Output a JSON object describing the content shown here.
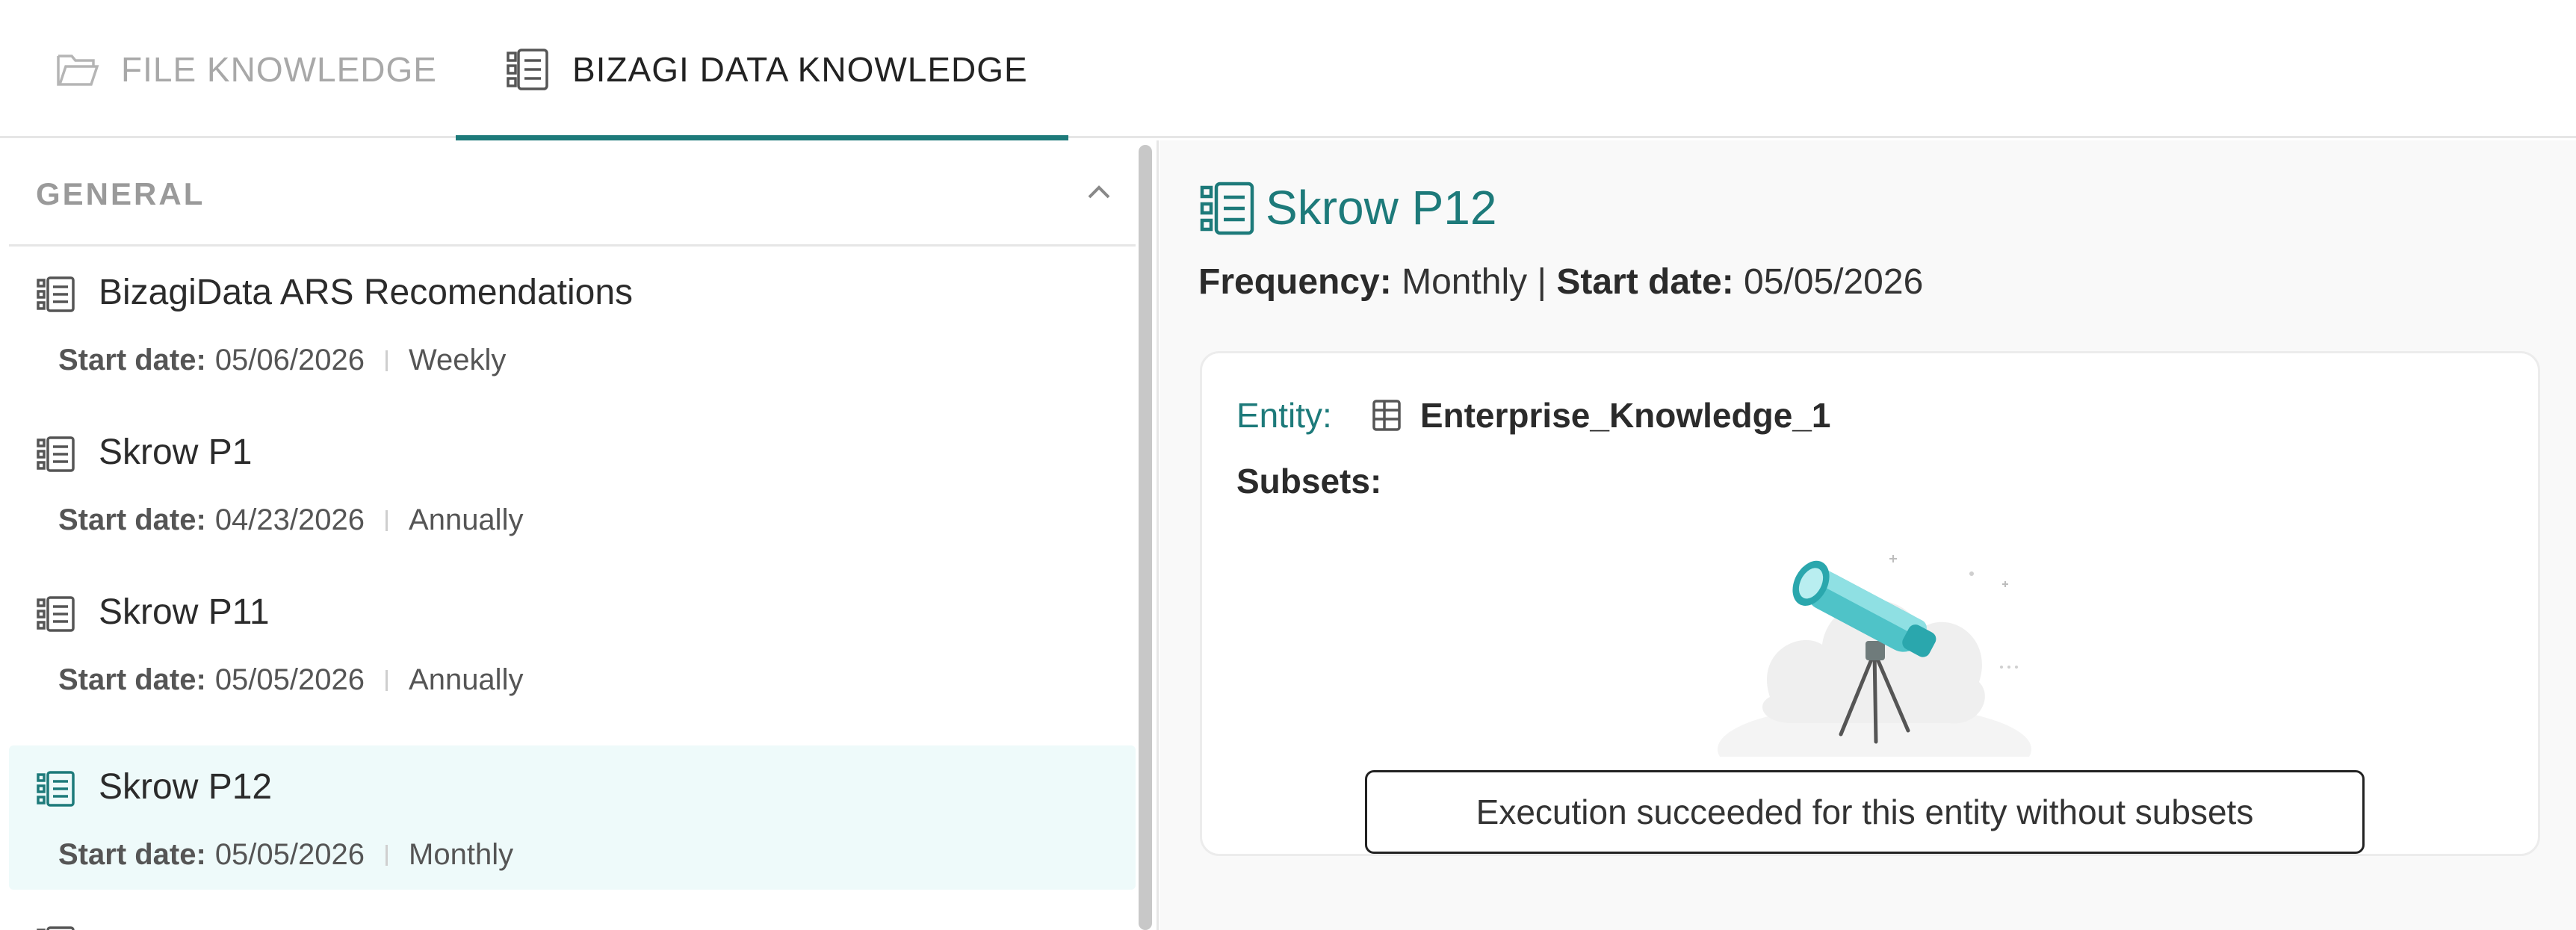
{
  "tabs": {
    "file": {
      "label": "FILE KNOWLEDGE",
      "icon": "folder-open-icon"
    },
    "bizagi": {
      "label": "BIZAGI DATA KNOWLEDGE",
      "icon": "data-list-icon"
    }
  },
  "sidebar": {
    "section_title": "GENERAL",
    "items": [
      {
        "name": "BizagiData ARS Recomendations",
        "start_label": "Start date:",
        "start_date": "05/06/2026",
        "frequency": "Weekly"
      },
      {
        "name": "Skrow P1",
        "start_label": "Start date:",
        "start_date": "04/23/2026",
        "frequency": "Annually"
      },
      {
        "name": "Skrow P11",
        "start_label": "Start date:",
        "start_date": "05/05/2026",
        "frequency": "Annually"
      },
      {
        "name": "Skrow P12",
        "start_label": "Start date:",
        "start_date": "05/05/2026",
        "frequency": "Monthly"
      }
    ]
  },
  "detail": {
    "title": "Skrow P12",
    "frequency_label": "Frequency:",
    "frequency": "Monthly",
    "separator": "|",
    "start_label": "Start date:",
    "start_date": "05/05/2026",
    "entity_label": "Entity:",
    "entity_name": "Enterprise_Knowledge_1",
    "subsets_label": "Subsets:",
    "message": "Execution succeeded for this entity without subsets"
  },
  "colors": {
    "accent": "#1d7a7a",
    "selected_bg": "#eefafa",
    "muted": "#a8a8a8"
  }
}
